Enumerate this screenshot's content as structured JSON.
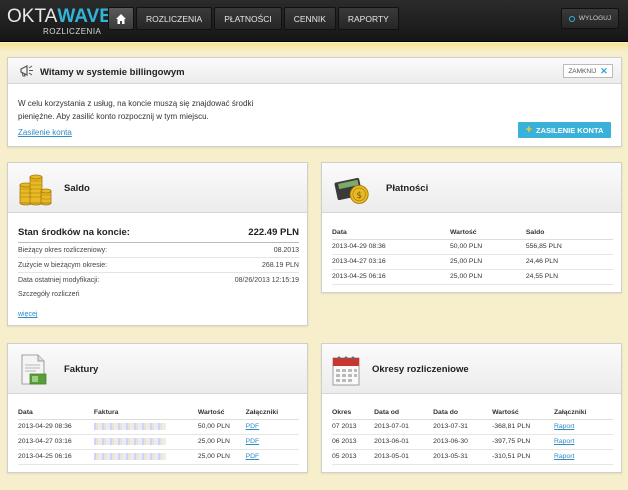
{
  "header": {
    "logo_part1": "OKTA",
    "logo_part2": "WAVE",
    "logo_sub": "ROZLICZENIA",
    "nav": [
      "ROZLICZENIA",
      "PŁATNOŚCI",
      "CENNIK",
      "RAPORTY"
    ],
    "logout_label": "WYLOGUJ"
  },
  "welcome": {
    "title": "Witamy w systemie billingowym",
    "close_label": "ZAMKNIJ",
    "text": "W celu korzystania z usług, na koncie muszą się znajdować środki pieniężne. Aby zasilić konto rozpocznij w tym miejscu.",
    "link": "Zasilenie konta",
    "button": "ZASILENIE KONTA"
  },
  "saldo": {
    "title": "Saldo",
    "balance_label": "Stan środków na koncie:",
    "balance_value": "222.49 PLN",
    "rows": [
      {
        "label": "Bieżący okres rozliczeniowy:",
        "value": "08.2013"
      },
      {
        "label": "Zużycie w bieżącym okresie:",
        "value": "268.19 PLN"
      },
      {
        "label": "Data ostatniej modyfikacji:",
        "value": "08/26/2013 12:15:19"
      }
    ],
    "details": "Szczegóły rozliczeń",
    "more": "więcej"
  },
  "platnosci": {
    "title": "Płatności",
    "headers": [
      "Data",
      "Wartość",
      "Saldo"
    ],
    "rows": [
      [
        "2013-04-29 08:36",
        "50,00 PLN",
        "556,85 PLN"
      ],
      [
        "2013-04-27 03:16",
        "25,00 PLN",
        "24,46 PLN"
      ],
      [
        "2013-04-25 06:16",
        "25,00 PLN",
        "24,55 PLN"
      ]
    ]
  },
  "faktury": {
    "title": "Faktury",
    "headers": [
      "Data",
      "Faktura",
      "Wartość",
      "Załączniki"
    ],
    "rows": [
      [
        "2013-04-29 08:36",
        "50,00 PLN",
        "PDF"
      ],
      [
        "2013-04-27 03:16",
        "25,00 PLN",
        "PDF"
      ],
      [
        "2013-04-25 06:16",
        "25,00 PLN",
        "PDF"
      ]
    ]
  },
  "okresy": {
    "title": "Okresy rozliczeniowe",
    "headers": [
      "Okres",
      "Data od",
      "Data do",
      "Wartość",
      "Załączniki"
    ],
    "rows": [
      [
        "07 2013",
        "2013-07-01",
        "2013-07-31",
        "-368,81 PLN",
        "Raport"
      ],
      [
        "06 2013",
        "2013-06-01",
        "2013-06-30",
        "-397,75 PLN",
        "Raport"
      ],
      [
        "05 2013",
        "2013-05-01",
        "2013-05-31",
        "-310,51 PLN",
        "Raport"
      ]
    ]
  }
}
